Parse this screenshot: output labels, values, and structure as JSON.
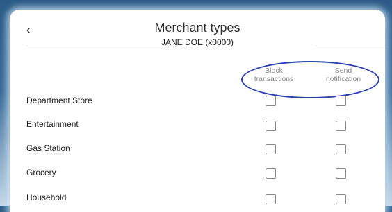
{
  "header": {
    "back_label": "‹",
    "title": "Merchant types",
    "subtitle": "JANE DOE (x0000)"
  },
  "columns": {
    "block": "Block\ntransactions",
    "send": "Send\nnotification"
  },
  "rows": [
    {
      "label": "Department Store",
      "block": false,
      "send": false
    },
    {
      "label": "Entertainment",
      "block": false,
      "send": false
    },
    {
      "label": "Gas Station",
      "block": false,
      "send": false
    },
    {
      "label": "Grocery",
      "block": false,
      "send": false
    },
    {
      "label": "Household",
      "block": false,
      "send": false
    }
  ],
  "colors": {
    "annotation_oval": "#2b3fae",
    "page_background": "#2a5a86"
  }
}
